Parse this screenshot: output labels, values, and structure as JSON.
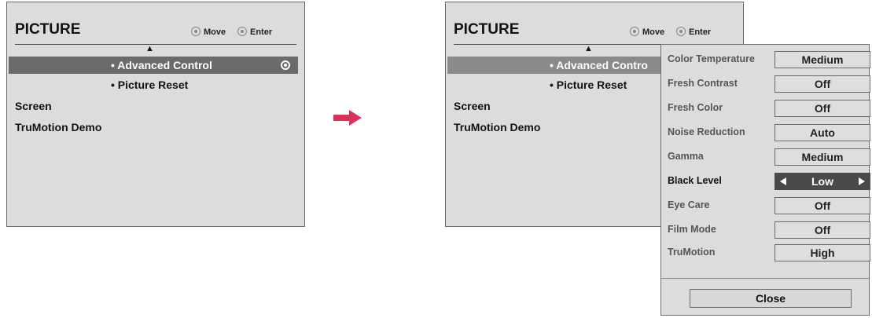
{
  "left_menu": {
    "title": "PICTURE",
    "move_label": "Move",
    "enter_label": "Enter",
    "items": [
      {
        "label": "• Advanced Control",
        "selected": true
      },
      {
        "label": "• Picture Reset"
      },
      {
        "label": "Screen"
      },
      {
        "label": "TruMotion Demo"
      }
    ]
  },
  "right_menu": {
    "title": "PICTURE",
    "move_label": "Move",
    "enter_label": "Enter",
    "items": [
      {
        "label": "• Advanced Contro"
      },
      {
        "label": "• Picture Reset"
      },
      {
        "label": "Screen"
      },
      {
        "label": "TruMotion Demo"
      }
    ]
  },
  "advanced_control": {
    "rows": [
      {
        "label": "Color Temperature",
        "value": "Medium"
      },
      {
        "label": "Fresh Contrast",
        "value": "Off"
      },
      {
        "label": "Fresh Color",
        "value": "Off"
      },
      {
        "label": "Noise Reduction",
        "value": "Auto"
      },
      {
        "label": "Gamma",
        "value": "Medium"
      },
      {
        "label": "Black Level",
        "value": "Low",
        "active": true
      },
      {
        "label": "Eye Care",
        "value": "Off"
      },
      {
        "label": "Film Mode",
        "value": "Off"
      },
      {
        "label": "TruMotion",
        "value": "High"
      }
    ],
    "close_label": "Close"
  },
  "colors": {
    "arrow": "#d6335a",
    "panel_bg": "#dcdcdc",
    "highlight": "#6b6b6b"
  }
}
